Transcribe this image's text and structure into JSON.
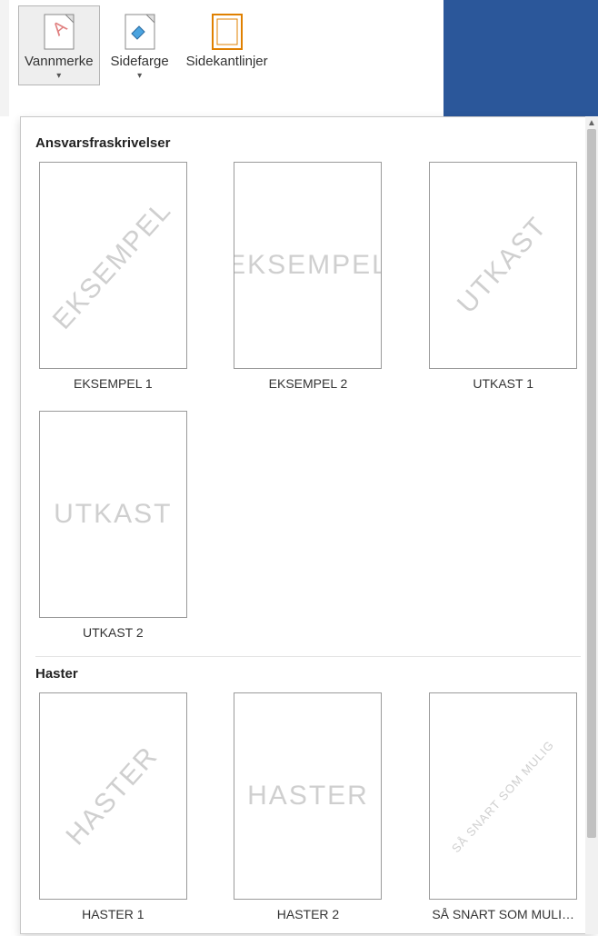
{
  "ribbon": {
    "watermark": {
      "label": "Vannmerke"
    },
    "pagecolor": {
      "label": "Sidefarge"
    },
    "borders": {
      "label": "Sidekantlinjer"
    }
  },
  "sections": [
    {
      "title": "Ansvarsfraskrivelser",
      "items": [
        {
          "caption": "EKSEMPEL 1",
          "wm": "EKSEMPEL",
          "style": "diag"
        },
        {
          "caption": "EKSEMPEL 2",
          "wm": "EKSEMPEL",
          "style": "horiz"
        },
        {
          "caption": "UTKAST 1",
          "wm": "UTKAST",
          "style": "diag"
        },
        {
          "caption": "UTKAST 2",
          "wm": "UTKAST",
          "style": "horiz"
        }
      ]
    },
    {
      "title": "Haster",
      "items": [
        {
          "caption": "HASTER 1",
          "wm": "HASTER",
          "style": "diag"
        },
        {
          "caption": "HASTER 2",
          "wm": "HASTER",
          "style": "horiz"
        },
        {
          "caption": "SÅ SNART SOM MULI…",
          "wm": "SÅ SNART SOM MULIG",
          "style": "diag-small"
        }
      ]
    }
  ]
}
